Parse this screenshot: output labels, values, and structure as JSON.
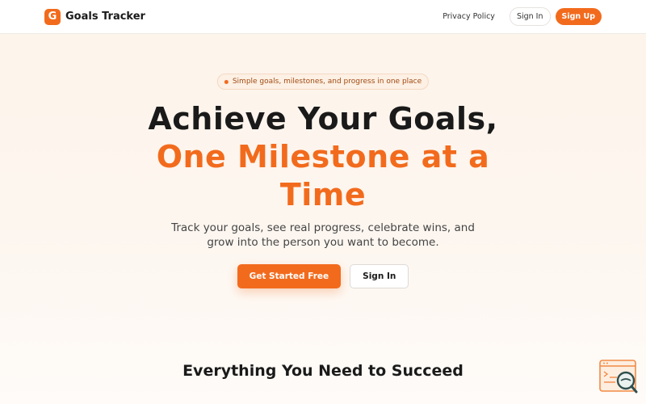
{
  "header": {
    "logo_letter": "G",
    "brand": "Goals Tracker",
    "nav": {
      "privacy": "Privacy Policy",
      "sign_in": "Sign In",
      "sign_up": "Sign Up"
    }
  },
  "hero": {
    "badge": "Simple goals, milestones, and progress in one place",
    "title_line1": "Achieve Your Goals,",
    "title_accent": "One Milestone at a Time",
    "subtitle": "Track your goals, see real progress, celebrate wins, and grow into the person you want to become.",
    "cta_primary": "Get Started Free",
    "cta_secondary": "Sign In"
  },
  "features": {
    "title": "Everything You Need to Succeed"
  },
  "colors": {
    "accent": "#f26b1d",
    "background": "#fdf3ea"
  },
  "icons": {
    "logo": "letter-g-logo",
    "corner": "search-document-icon"
  }
}
